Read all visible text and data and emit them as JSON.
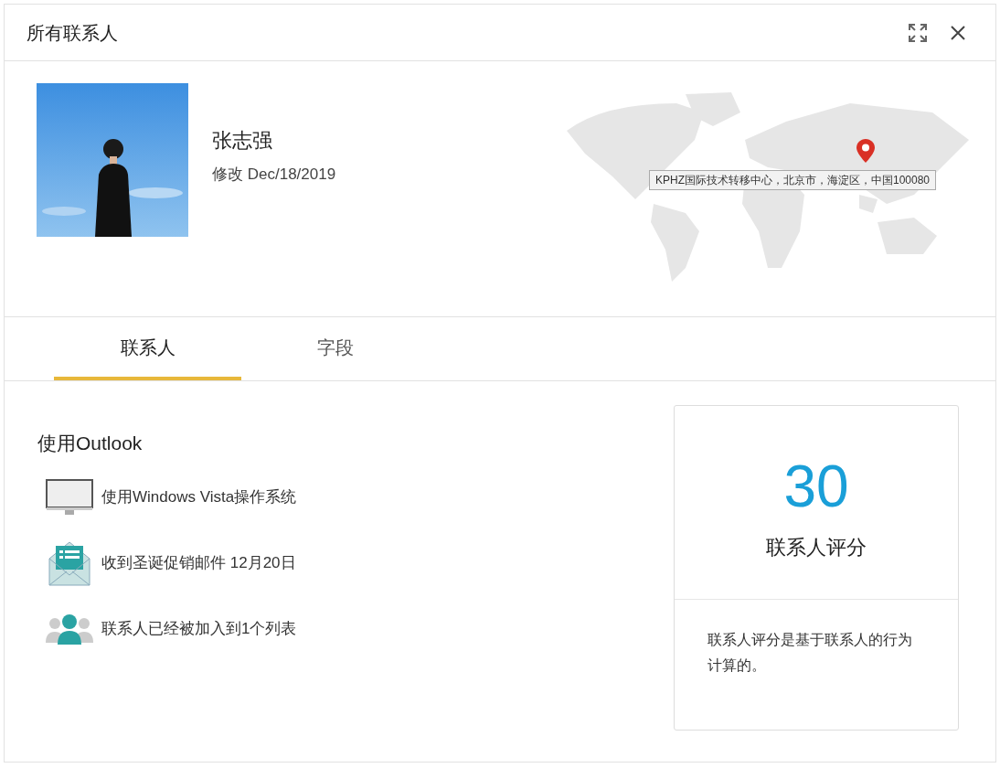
{
  "window": {
    "title": "所有联系人"
  },
  "contact": {
    "name": "张志强",
    "modified": "修改 Dec/18/2019",
    "address": "KPHZ国际技术转移中心，北京市，海淀区，中国100080"
  },
  "tabs": [
    {
      "label": "联系人",
      "selected": true
    },
    {
      "label": "字段",
      "selected": false
    }
  ],
  "section": {
    "title": "使用Outlook",
    "items": [
      {
        "kind": "computer",
        "text": "使用Windows Vista操作系统"
      },
      {
        "kind": "mail",
        "text": "收到圣诞促销邮件 12月20日"
      },
      {
        "kind": "group",
        "text": "联系人已经被加入到1个列表"
      }
    ]
  },
  "score": {
    "value": "30",
    "label": "联系人评分",
    "description": "联系人评分是基于联系人的行为计算的。"
  }
}
